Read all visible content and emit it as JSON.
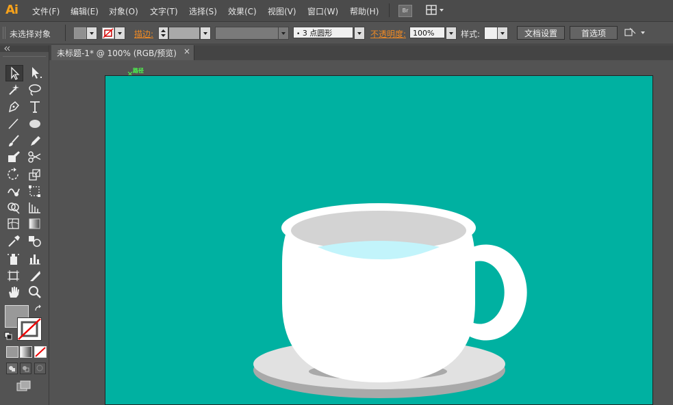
{
  "app": {
    "logo": "Ai"
  },
  "menu": [
    "文件(F)",
    "编辑(E)",
    "对象(O)",
    "文字(T)",
    "选择(S)",
    "效果(C)",
    "视图(V)",
    "窗口(W)",
    "帮助(H)"
  ],
  "bridge_label": "Br",
  "control": {
    "selection_status": "未选择对象",
    "stroke_label": "描边:",
    "brush_value": "3 点圆形",
    "opacity_label": "不透明度:",
    "opacity_value": "100%",
    "style_label": "样式:",
    "doc_setup_button": "文档设置",
    "prefs_button": "首选项"
  },
  "document_tab": {
    "title": "未标题-1* @ 100% (RGB/预览)",
    "close": "×"
  },
  "canvas": {
    "path_hint": "路径"
  },
  "colors": {
    "artboard": "#00b1a1",
    "cup": "#ffffff",
    "cup_interior": "#d3d3d3",
    "tea": "#c2f4fb",
    "saucer": "#e1e1e1",
    "saucer_edge": "#a9a9a9",
    "accent_orange": "#f08a24"
  }
}
